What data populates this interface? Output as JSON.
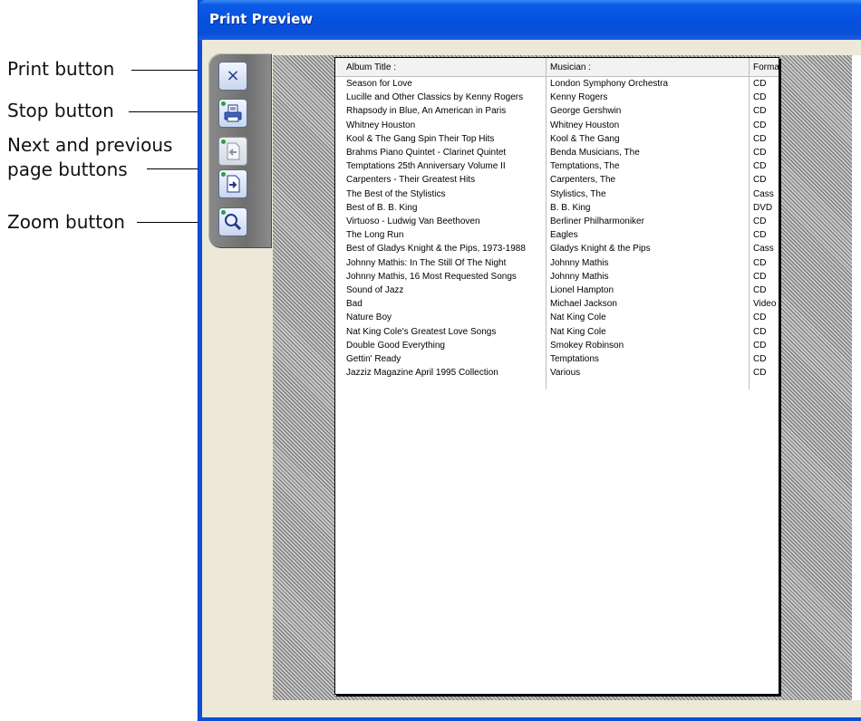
{
  "callouts": [
    {
      "label": "Print button"
    },
    {
      "label": "Stop button"
    },
    {
      "label": "Next and previous"
    },
    {
      "label": "page buttons"
    },
    {
      "label": "Zoom button"
    }
  ],
  "window": {
    "title": "Print Preview"
  },
  "toolbar": {
    "buttons": [
      {
        "name": "close",
        "glyph": "×"
      },
      {
        "name": "print",
        "glyph": ""
      },
      {
        "name": "previous-page",
        "glyph": ""
      },
      {
        "name": "next-page",
        "glyph": ""
      },
      {
        "name": "zoom",
        "glyph": ""
      }
    ]
  },
  "report": {
    "headers": [
      "Album Title :",
      "Musician :",
      "Forma"
    ],
    "rows": [
      [
        "Season for Love",
        "London Symphony Orchestra",
        "CD"
      ],
      [
        "Lucille and Other Classics by Kenny Rogers",
        "Kenny Rogers",
        "CD"
      ],
      [
        "Rhapsody in Blue, An American in Paris",
        "George Gershwin",
        "CD"
      ],
      [
        "Whitney Houston",
        "Whitney Houston",
        "CD"
      ],
      [
        "Kool & The Gang Spin Their Top Hits",
        "Kool & The Gang",
        "CD"
      ],
      [
        "Brahms Piano Quintet - Clarinet Quintet",
        "Benda Musicians, The",
        "CD"
      ],
      [
        "Temptations 25th Anniversary Volume II",
        "Temptations, The",
        "CD"
      ],
      [
        "Carpenters - Their Greatest Hits",
        "Carpenters, The",
        "CD"
      ],
      [
        "The Best of the Stylistics",
        "Stylistics, The",
        "Cass"
      ],
      [
        "Best of B. B. King",
        "B. B. King",
        "DVD"
      ],
      [
        "Virtuoso - Ludwig Van Beethoven",
        "Berliner Philharmoniker",
        "CD"
      ],
      [
        "The Long Run",
        "Eagles",
        "CD"
      ],
      [
        "Best of Gladys Knight & the Pips, 1973-1988",
        "Gladys Knight & the Pips",
        "Cass"
      ],
      [
        "Johnny Mathis: In The Still Of The Night",
        "Johnny Mathis",
        "CD"
      ],
      [
        "Johnny Mathis, 16 Most Requested Songs",
        "Johnny Mathis",
        "CD"
      ],
      [
        "Sound of Jazz",
        "Lionel Hampton",
        "CD"
      ],
      [
        "Bad",
        "Michael Jackson",
        "Video"
      ],
      [
        "Nature Boy",
        "Nat King Cole",
        "CD"
      ],
      [
        "Nat King Cole's Greatest Love Songs",
        "Nat King Cole",
        "CD"
      ],
      [
        "Double Good Everything",
        "Smokey Robinson",
        "CD"
      ],
      [
        "Gettin' Ready",
        "Temptations",
        "CD"
      ],
      [
        "Jazziz Magazine April 1995 Collection",
        "Various",
        "CD"
      ]
    ]
  },
  "colors": {
    "titlebar": "#0550de",
    "client": "#ece9d8",
    "toolbar": "#7a7a7a"
  }
}
